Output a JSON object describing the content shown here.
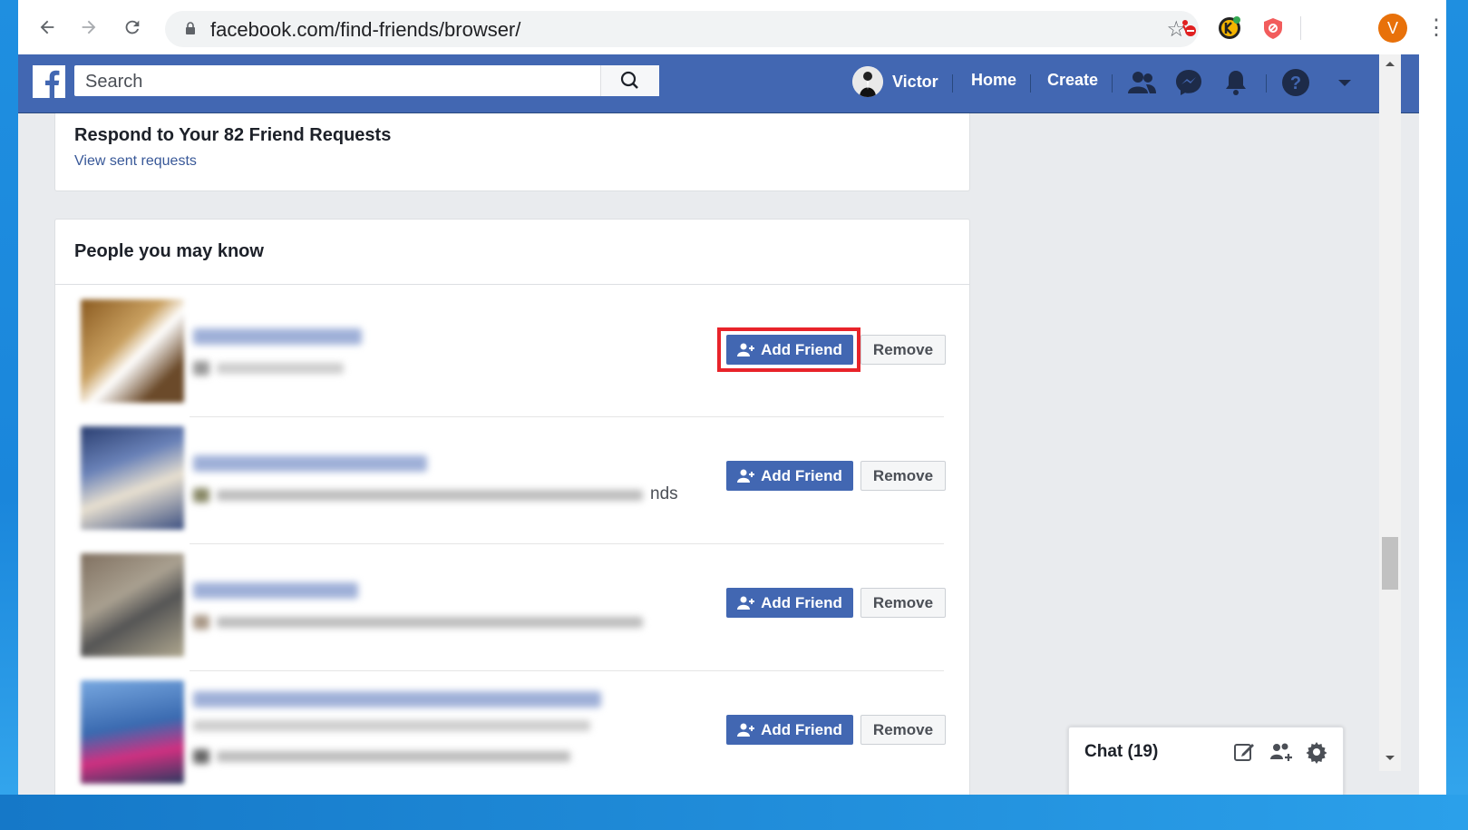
{
  "browser": {
    "url": "facebook.com/find-friends/browser/",
    "profile_initial": "V",
    "profile_color": "#e8710a"
  },
  "fb_header": {
    "search_placeholder": "Search",
    "user_name": "Victor",
    "home_label": "Home",
    "create_label": "Create",
    "brand_color": "#4267b2"
  },
  "requests": {
    "title": "Respond to Your 82 Friend Requests",
    "sent_link": "View sent requests"
  },
  "pymk": {
    "title": "People you may know",
    "partial_text": "nds",
    "people": [
      {
        "add_label": "Add Friend",
        "remove_label": "Remove"
      },
      {
        "add_label": "Add Friend",
        "remove_label": "Remove"
      },
      {
        "add_label": "Add Friend",
        "remove_label": "Remove"
      },
      {
        "add_label": "Add Friend",
        "remove_label": "Remove"
      }
    ]
  },
  "chat": {
    "label": "Chat (19)"
  },
  "highlight_color": "#e8232a"
}
